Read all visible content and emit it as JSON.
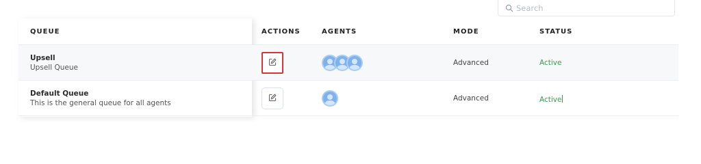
{
  "search": {
    "placeholder": "Search"
  },
  "table": {
    "columns": {
      "queue": "QUEUE",
      "actions": "ACTIONS",
      "agents": "AGENTS",
      "mode": "MODE",
      "status": "STATUS"
    },
    "rows": [
      {
        "name": "Upsell",
        "description": "Upsell Queue",
        "agent_count": 3,
        "mode": "Advanced",
        "status": "Active"
      },
      {
        "name": "Default Queue",
        "description": "This is the general queue for all agents",
        "agent_count": 1,
        "mode": "Advanced",
        "status": "Active"
      }
    ]
  },
  "colors": {
    "status_active": "#3d9a4d",
    "avatar": "#7fb2ec",
    "focus_outline": "#d9343a"
  },
  "icons": {
    "search": "search-icon",
    "edit": "edit-icon",
    "avatar": "user-avatar-icon"
  }
}
